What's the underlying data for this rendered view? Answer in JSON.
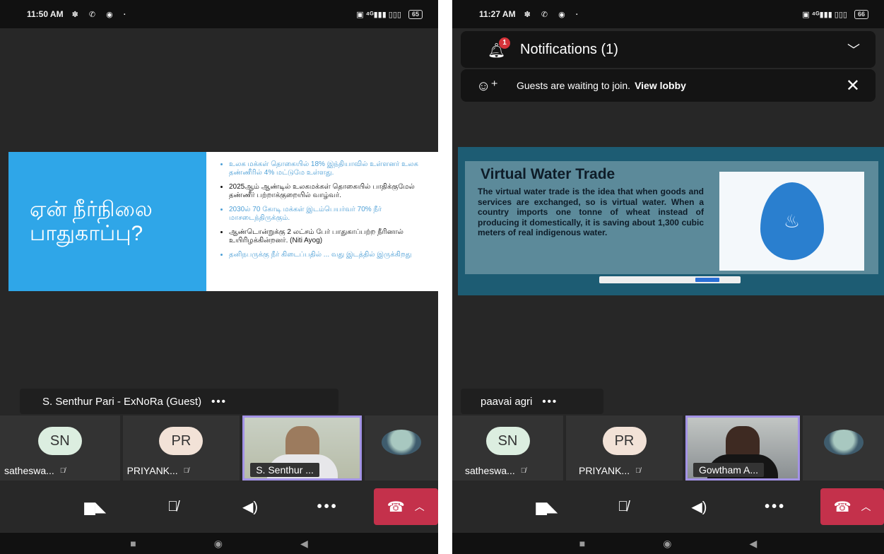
{
  "left_phone": {
    "status": {
      "time": "11:50 AM",
      "battery": "65"
    },
    "slide": {
      "title": "ஏன் நீர்நிலை பாதுகாப்பு?",
      "bullets": [
        "உலக மக்கள் தொகையில் 18% இந்தியாவில் உள்ளனர் உலக தண்ணீரில் 4% மட்டுமே உள்ளது.",
        "2025ஆம் ஆண்டில் உலகமக்கள் தொகையில் பாதிக்குமேல் தண்ணீர் பற்றாக்குறையில் வாழ்வர்.",
        "2030ல் 70 கோடி மக்கள் இடம்பெயர்வர் 70% நீர் மாசடைந்திருக்கும்.",
        "ஆண்டொன்றுக்கு 2 லட்சம் பேர் பாதுகாப்பற்ற நீரினால் உயிரிழக்கின்றனர். (Niti Ayog)",
        "தனிநபருக்கு நீர் கிடைப்பதில் ... வது இடத்தில் இருக்கிறது"
      ]
    },
    "presenter_name": "S. Senthur Pari - ExNoRa (Guest)",
    "more_label": "•••",
    "participants": [
      {
        "initials": "SN",
        "name": "satheswa..."
      },
      {
        "initials": "PR",
        "name": "PRIYANK..."
      },
      {
        "name": "S. Senthur ..."
      }
    ]
  },
  "right_phone": {
    "status": {
      "time": "11:27 AM",
      "battery": "66"
    },
    "notifications": {
      "title": "Notifications (1)",
      "badge": "1",
      "guest_text": "Guests are waiting to join.",
      "guest_link": "View lobby"
    },
    "slide": {
      "title": "Virtual Water Trade",
      "body": "The virtual water trade is the idea that when goods and services are exchanged, so is virtual water. When a country imports one tonne of wheat instead of producing it domestically, it is saving about 1,300 cubic meters of real indigenous water."
    },
    "presenter_name": "paavai agri",
    "more_label": "•••",
    "participants": [
      {
        "initials": "SN",
        "name": "satheswa..."
      },
      {
        "initials": "PR",
        "name": "PRIYANK..."
      },
      {
        "name": "Gowtham A..."
      }
    ]
  },
  "controls": {
    "camera_icon": "camera-off-icon",
    "mic_icon": "mic-off-icon",
    "speaker_icon": "speaker-icon",
    "more": "•••",
    "hangup_icon": "phone-hangup-icon"
  },
  "colors": {
    "hangup": "#c4314b",
    "video_border": "#a393e6",
    "slide_blue": "#2fa6e8",
    "slide_teal": "#1d5c73"
  }
}
